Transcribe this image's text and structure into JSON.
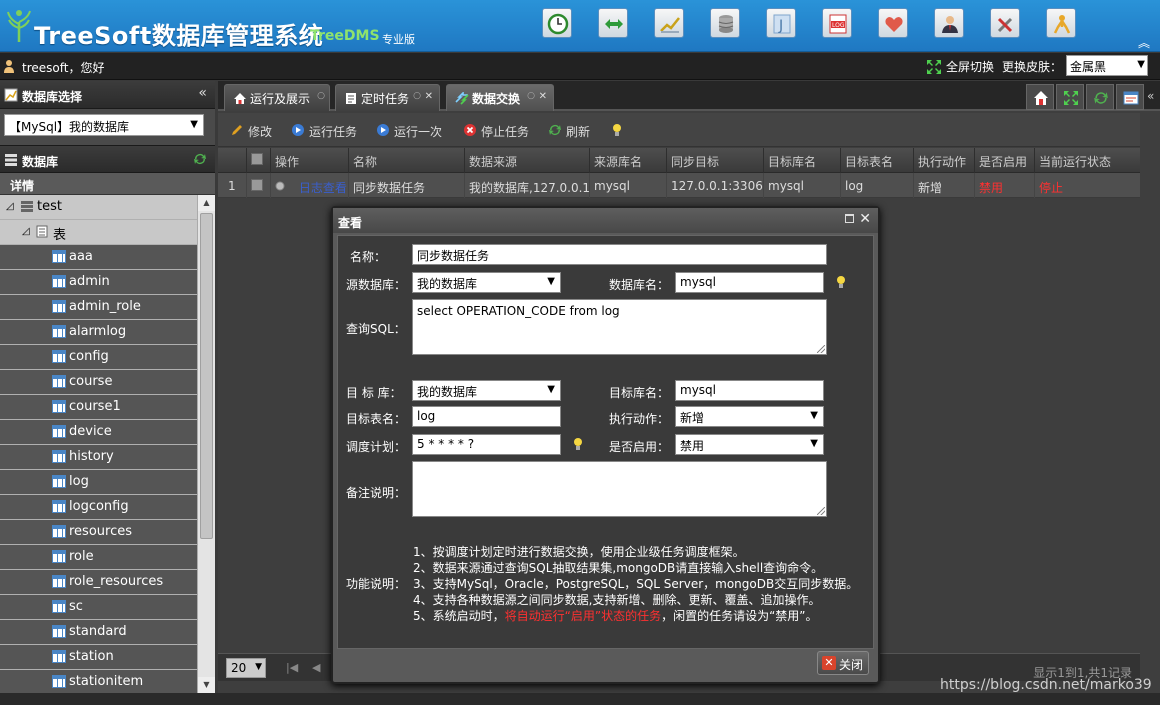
{
  "header": {
    "title": "TreeSoft数据库管理系统",
    "subtitle": "TreeDMS",
    "edition": "专业版",
    "tools": [
      "clock-icon",
      "swap-icon",
      "chart-icon",
      "database-icon",
      "j-icon",
      "log-icon",
      "heart-icon",
      "user-icon",
      "tools-icon",
      "person-icon"
    ]
  },
  "userbar": {
    "greeting": "treesoft，您好",
    "fullscreen": "全屏切换",
    "skin_label": "更换皮肤：",
    "skin_value": "金属黑"
  },
  "left": {
    "db_select_title": "数据库选择",
    "db_select_value": "【MySql】我的数据库",
    "db_panel_title": "数据库",
    "detail_title": "详情",
    "tree_root": "test",
    "tree_group": "表",
    "tables": [
      "aaa",
      "admin",
      "admin_role",
      "alarmlog",
      "config",
      "course",
      "course1",
      "device",
      "history",
      "log",
      "logconfig",
      "resources",
      "role",
      "role_resources",
      "sc",
      "standard",
      "station",
      "stationitem"
    ]
  },
  "tabs": [
    {
      "label": "运行及展示"
    },
    {
      "label": "定时任务"
    },
    {
      "label": "数据交换"
    }
  ],
  "toolbar": {
    "edit": "修改",
    "run_task": "运行任务",
    "run_once": "运行一次",
    "stop_task": "停止任务",
    "refresh": "刷新"
  },
  "grid": {
    "headers": [
      "操作",
      "名称",
      "数据来源",
      "来源库名",
      "同步目标",
      "目标库名",
      "目标表名",
      "执行动作",
      "是否启用",
      "当前运行状态"
    ],
    "row": {
      "index": "1",
      "op": "日志查看",
      "name": "同步数据任务",
      "source": "我的数据库,127.0.0.1:3306",
      "source_db": "mysql",
      "target": "127.0.0.1:3306",
      "target_db": "mysql",
      "target_table": "log",
      "action": "新增",
      "enabled": "禁用",
      "status": "停止"
    }
  },
  "pager": {
    "page_size": "20",
    "info": "显示1到1,共1记录"
  },
  "dialog": {
    "title": "查看",
    "name_label": "名称：",
    "name_value": "同步数据任务",
    "src_db_label": "源数据库：",
    "src_db_value": "我的数据库",
    "db_name_label": "数据库名：",
    "db_name_value": "mysql",
    "sql_label": "查询SQL：",
    "sql_value": "select  OPERATION_CODE from log",
    "target_db_label": "目 标 库：",
    "target_db_value": "我的数据库",
    "target_dbname_label": "目标库名：",
    "target_dbname_value": "mysql",
    "target_table_label": "目标表名：",
    "target_table_value": "log",
    "action_label": "执行动作：",
    "action_value": "新增",
    "schedule_label": "调度计划：",
    "schedule_value": "5 * * * * ?",
    "enabled_label": "是否启用：",
    "enabled_value": "禁用",
    "remark_label": "备注说明：",
    "func_label": "功能说明：",
    "func_1": "1、按调度计划定时进行数据交换，使用企业级任务调度框架。",
    "func_2": "2、数据来源通过查询SQL抽取结果集,mongoDB请直接输入shell查询命令。",
    "func_3": "3、支持MySql，Oracle，PostgreSQL，SQL Server，mongoDB交互同步数据。",
    "func_4": "4、支持各种数据源之间同步数据,支持新增、删除、更新、覆盖、追加操作。",
    "func_5a": "5、系统启动时，",
    "func_5b": "将自动运行“启用”状态的任务",
    "func_5c": "，闲置的任务请设为“禁用”。",
    "close_button": "关闭"
  },
  "watermark": "https://blog.csdn.net/marko39",
  "colors": {
    "header_blue": "#1f78c2",
    "accent_green": "#8fe36c",
    "status_red": "#ff3030"
  }
}
